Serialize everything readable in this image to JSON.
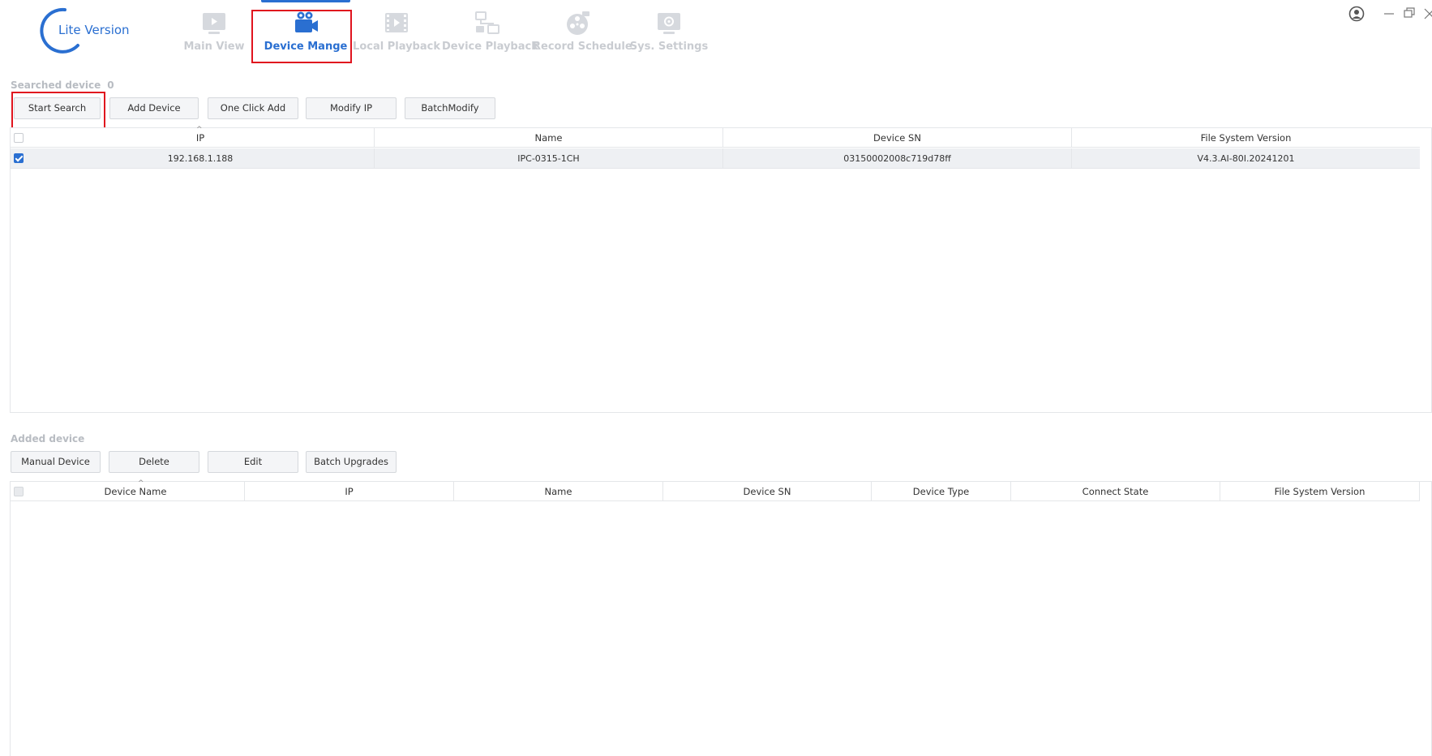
{
  "app": {
    "logo_text": "Lite Version",
    "accent_color": "#2a6fd1",
    "highlight_color": "#e0141e"
  },
  "nav": {
    "items": [
      {
        "label": "Main View",
        "icon": "monitor-play-icon",
        "active": false
      },
      {
        "label": "Device Mange",
        "icon": "video-camera-icon",
        "active": true
      },
      {
        "label": "Local Playback",
        "icon": "film-play-icon",
        "active": false
      },
      {
        "label": "Device Playback",
        "icon": "network-devices-icon",
        "active": false
      },
      {
        "label": "Record Schedule",
        "icon": "film-reel-icon",
        "active": false
      },
      {
        "label": "Sys. Settings",
        "icon": "settings-monitor-icon",
        "active": false
      }
    ]
  },
  "window_controls": [
    "user-icon",
    "minimize-icon",
    "maximize-icon",
    "close-icon"
  ],
  "searched": {
    "label": "Searched device",
    "count": "0",
    "buttons": {
      "start_search": "Start Search",
      "add_device": "Add Device",
      "one_click_add": "One Click Add",
      "modify_ip": "Modify IP",
      "batch_modify": "BatchModify"
    },
    "columns": [
      "IP",
      "Name",
      "Device SN",
      "File System Version"
    ],
    "rows": [
      {
        "checked": true,
        "ip": "192.168.1.188",
        "name": "IPC-0315-1CH",
        "sn": "03150002008c719d78ff",
        "fs_version": "V4.3.AI-80I.20241201"
      }
    ]
  },
  "added": {
    "label": "Added device",
    "buttons": {
      "manual_device": "Manual Device",
      "delete": "Delete",
      "edit": "Edit",
      "batch_upgrades": "Batch Upgrades"
    },
    "columns": [
      "Device Name",
      "IP",
      "Name",
      "Device SN",
      "Device Type",
      "Connect State",
      "File System Version"
    ],
    "rows": []
  }
}
